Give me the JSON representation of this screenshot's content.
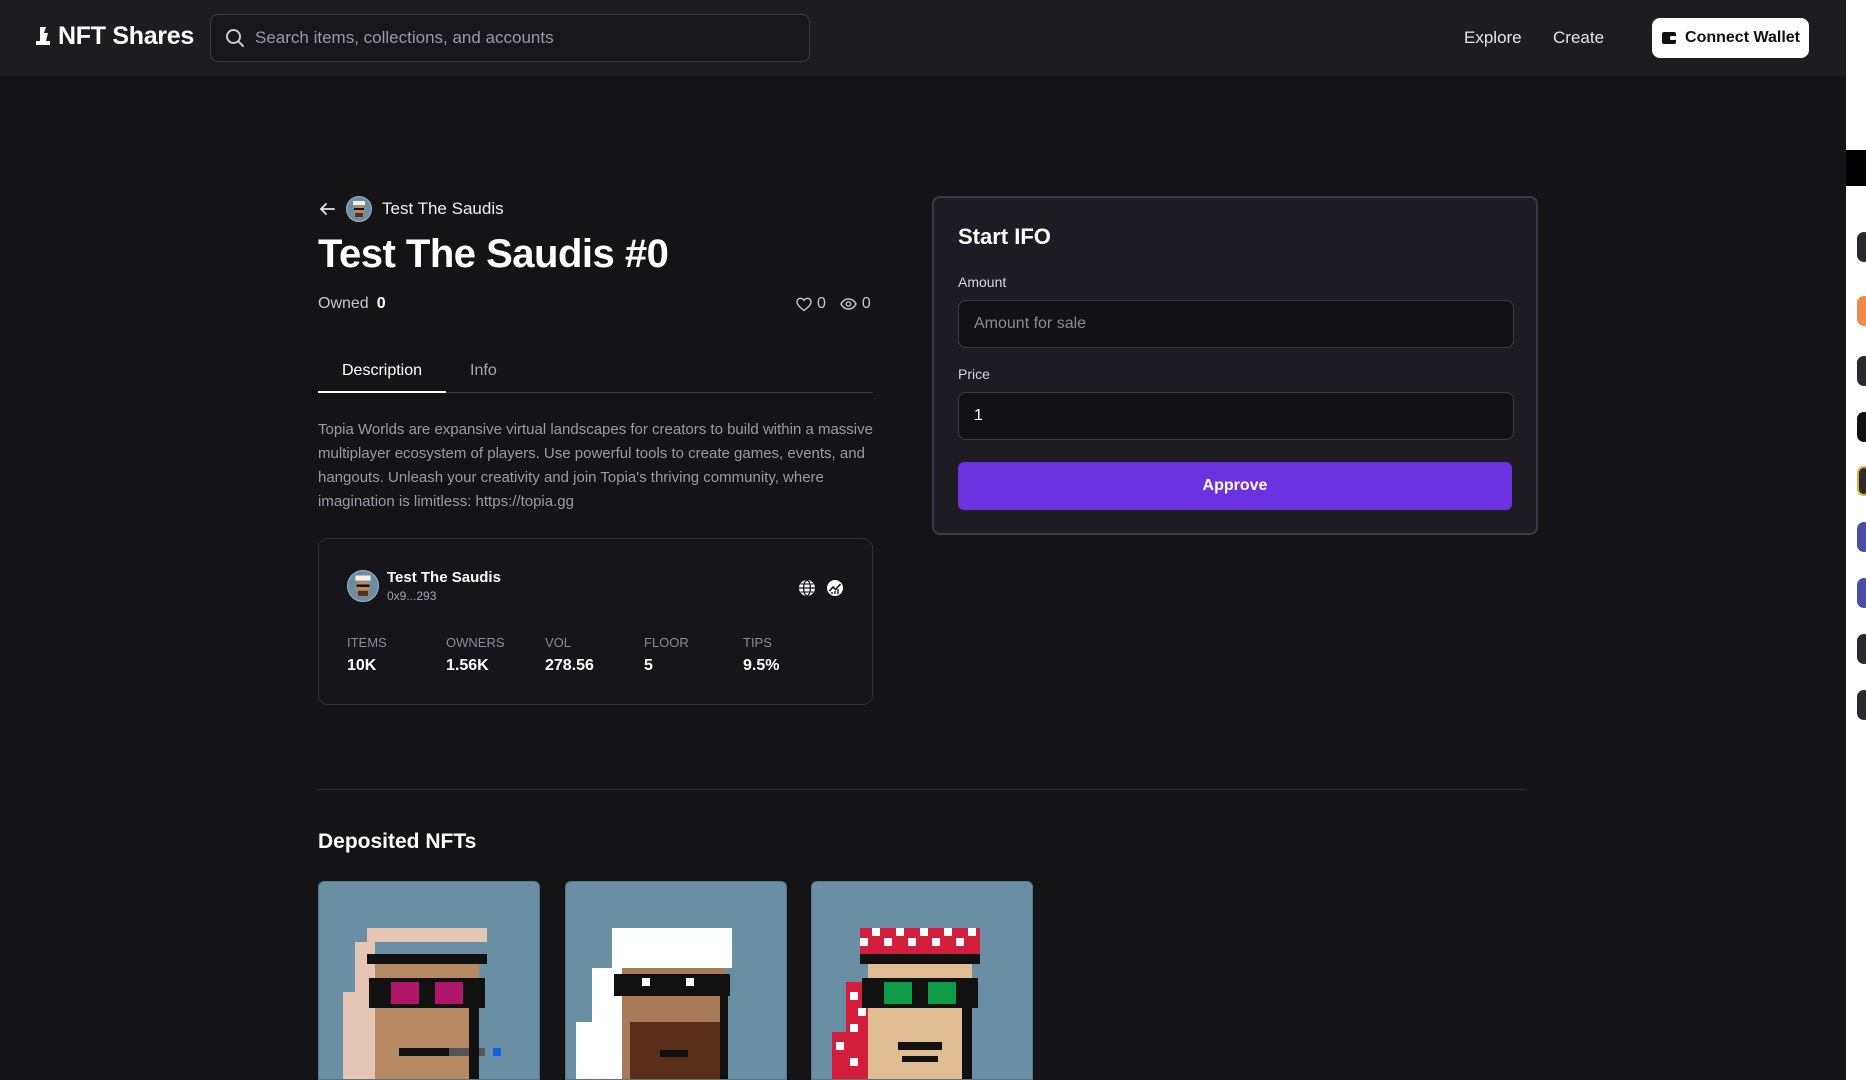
{
  "header": {
    "brand": "NFT Shares",
    "search_placeholder": "Search items, collections, and accounts",
    "nav": [
      "Explore",
      "Create"
    ],
    "connect_label": "Connect Wallet"
  },
  "item": {
    "collection_name": "Test The Saudis",
    "title": "Test The Saudis #0",
    "owned_label": "Owned",
    "owned_value": "0",
    "likes": "0",
    "views": "0"
  },
  "tabs": [
    "Description",
    "Info"
  ],
  "description": "Topia Worlds are expansive virtual landscapes for creators to build within a massive multiplayer ecosystem of players. Use powerful tools to create games, events, and hangouts. Unleash your creativity and join Topia's thriving community, where imagination is limitless: https://topia.gg",
  "collection_card": {
    "name": "Test The Saudis",
    "address": "0x9...293",
    "stats": [
      {
        "label": "ITEMS",
        "value": "10K"
      },
      {
        "label": "OWNERS",
        "value": "1.56K"
      },
      {
        "label": "VOL",
        "value": "278.56"
      },
      {
        "label": "FLOOR",
        "value": "5"
      },
      {
        "label": "TIPS",
        "value": "9.5%"
      }
    ]
  },
  "ifo": {
    "title": "Start IFO",
    "amount_label": "Amount",
    "amount_placeholder": "Amount for sale",
    "price_label": "Price",
    "price_value": "1",
    "approve_label": "Approve"
  },
  "deposited": {
    "title": "Deposited NFTs"
  },
  "colors": {
    "accent": "#6d32e0",
    "background": "#141417",
    "header": "#1c1c21",
    "card_bg": "#6a8ea3"
  },
  "icons": [
    "logo-icon",
    "search-icon",
    "wallet-icon",
    "back-arrow-icon",
    "heart-icon",
    "eye-icon",
    "globe-icon",
    "chart-icon"
  ]
}
